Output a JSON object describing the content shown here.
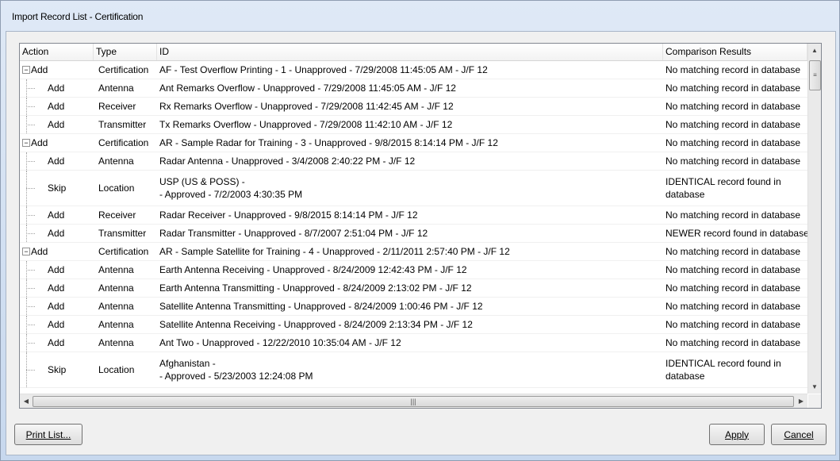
{
  "window": {
    "title": "Import Record List - Certification"
  },
  "list": {
    "columns": [
      "Action",
      "Type",
      "ID",
      "Comparison Results"
    ],
    "rows": [
      {
        "action": "Add",
        "level": "parent",
        "type": "Certification",
        "id": "AF - Test Overflow Printing - 1 - Unapproved - 7/29/2008 11:45:05 AM - J/F 12",
        "result": "No matching record in database"
      },
      {
        "action": "Add",
        "level": "child",
        "type": "Antenna",
        "id": "Ant Remarks Overflow - Unapproved - 7/29/2008 11:45:05 AM - J/F 12",
        "result": "No matching record in database"
      },
      {
        "action": "Add",
        "level": "child",
        "type": "Receiver",
        "id": "Rx Remarks Overflow - Unapproved - 7/29/2008 11:42:45 AM - J/F 12",
        "result": "No matching record in database"
      },
      {
        "action": "Add",
        "level": "child",
        "type": "Transmitter",
        "id": "Tx Remarks Overflow - Unapproved - 7/29/2008 11:42:10 AM - J/F 12",
        "result": "No matching record in database"
      },
      {
        "action": "Add",
        "level": "parent",
        "type": "Certification",
        "id": "AR - Sample Radar for Training - 3 - Unapproved - 9/8/2015 8:14:14 PM - J/F 12",
        "result": "No matching record in database"
      },
      {
        "action": "Add",
        "level": "child",
        "type": "Antenna",
        "id": "Radar Antenna - Unapproved - 3/4/2008 2:40:22 PM - J/F 12",
        "result": "No matching record in database"
      },
      {
        "action": "Skip",
        "level": "child",
        "type": "Location",
        "id": "USP (US & POSS) -",
        "id2": "- Approved - 7/2/2003 4:30:35 PM",
        "result": "IDENTICAL record found in",
        "result2": "database"
      },
      {
        "action": "Add",
        "level": "child",
        "type": "Receiver",
        "id": "Radar Receiver - Unapproved - 9/8/2015 8:14:14 PM - J/F 12",
        "result": "No matching record in database"
      },
      {
        "action": "Add",
        "level": "child",
        "type": "Transmitter",
        "id": "Radar Transmitter - Unapproved - 8/7/2007 2:51:04 PM - J/F 12",
        "result": "NEWER record found in database"
      },
      {
        "action": "Add",
        "level": "parent",
        "type": "Certification",
        "id": "AR - Sample Satellite for Training - 4 - Unapproved - 2/11/2011 2:57:40 PM - J/F 12",
        "result": "No matching record in database"
      },
      {
        "action": "Add",
        "level": "child",
        "type": "Antenna",
        "id": "Earth Antenna Receiving - Unapproved - 8/24/2009 12:42:43 PM - J/F 12",
        "result": "No matching record in database"
      },
      {
        "action": "Add",
        "level": "child",
        "type": "Antenna",
        "id": "Earth Antenna Transmitting - Unapproved - 8/24/2009 2:13:02 PM - J/F 12",
        "result": "No matching record in database"
      },
      {
        "action": "Add",
        "level": "child",
        "type": "Antenna",
        "id": "Satellite Antenna Transmitting - Unapproved - 8/24/2009 1:00:46 PM - J/F 12",
        "result": "No matching record in database"
      },
      {
        "action": "Add",
        "level": "child",
        "type": "Antenna",
        "id": "Satellite Antenna Receiving - Unapproved - 8/24/2009 2:13:34 PM - J/F 12",
        "result": "No matching record in database"
      },
      {
        "action": "Add",
        "level": "child",
        "type": "Antenna",
        "id": "Ant Two - Unapproved - 12/22/2010 10:35:04 AM - J/F 12",
        "result": "No matching record in database"
      },
      {
        "action": "Skip",
        "level": "child",
        "type": "Location",
        "id": "Afghanistan -",
        "id2": "- Approved - 5/23/2003 12:24:08 PM",
        "result": "IDENTICAL record found in",
        "result2": "database"
      }
    ]
  },
  "icons": {
    "expander": "collapse-minus-icon",
    "scroll_up": "scroll-up-arrow-icon",
    "scroll_down": "scroll-down-arrow-icon",
    "scroll_left": "scroll-left-arrow-icon",
    "scroll_right": "scroll-right-arrow-icon"
  },
  "buttons": {
    "print_list": "Print List...",
    "apply": "Apply",
    "cancel": "Cancel"
  }
}
